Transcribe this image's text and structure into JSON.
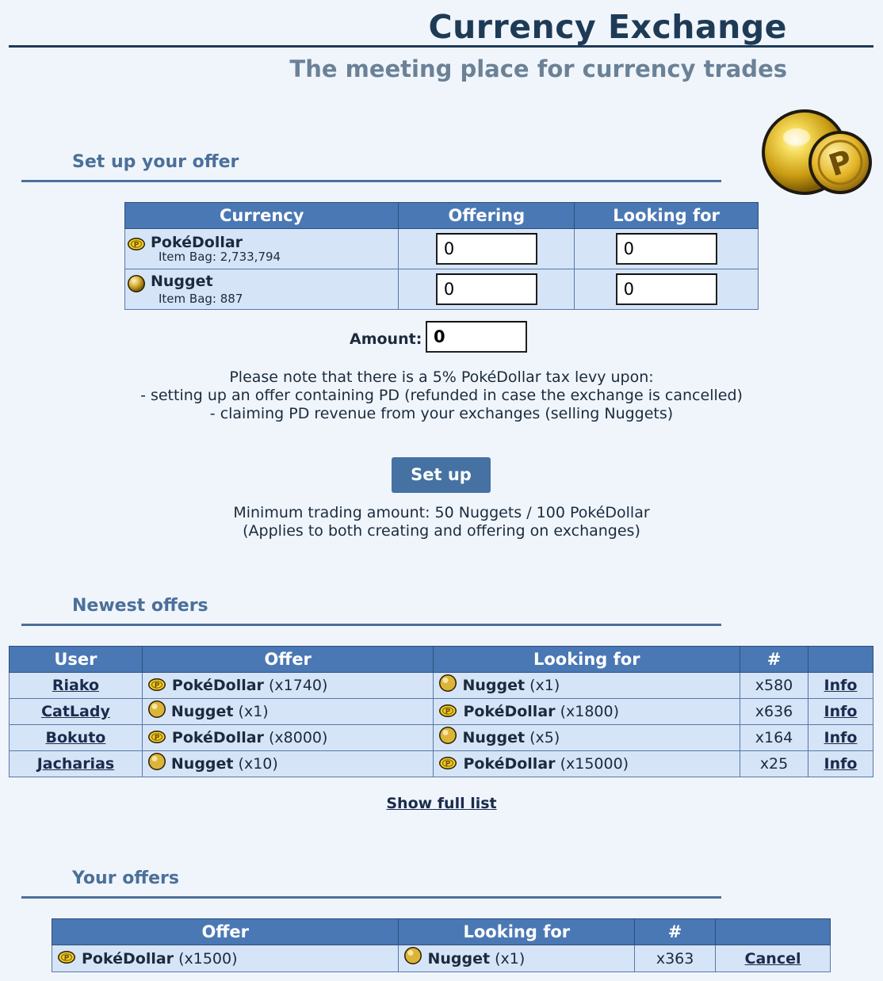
{
  "header": {
    "title": "Currency Exchange",
    "subtitle": "The meeting place for currency trades"
  },
  "setup": {
    "section_title": "Set up your offer",
    "columns": [
      "Currency",
      "Offering",
      "Looking for"
    ],
    "rows": [
      {
        "icon": "pokedollar-icon",
        "name": "PokéDollar",
        "bag": "Item Bag: 2,733,794",
        "offering": "0",
        "looking": "0"
      },
      {
        "icon": "nugget-icon",
        "name": "Nugget",
        "bag": "Item Bag: 887",
        "offering": "0",
        "looking": "0"
      }
    ],
    "amount_label": "Amount:",
    "amount_value": "0",
    "tax_note": [
      "Please note that there is a 5% PokéDollar tax levy upon:",
      "- setting up an offer containing PD (refunded in case the exchange is cancelled)",
      "- claiming PD revenue from your exchanges (selling Nuggets)"
    ],
    "button_label": "Set up",
    "min_note": [
      "Minimum trading amount: 50 Nuggets / 100 PokéDollar",
      "(Applies to both creating and offering on exchanges)"
    ]
  },
  "newest": {
    "section_title": "Newest offers",
    "columns": [
      "User",
      "Offer",
      "Looking for",
      "#",
      ""
    ],
    "rows": [
      {
        "user": "Riako",
        "offer_icon": "pokedollar-icon",
        "offer_name": "PokéDollar",
        "offer_qty": "(x1740)",
        "want_icon": "nugget-icon",
        "want_name": "Nugget",
        "want_qty": "(x1)",
        "count": "x580",
        "info": "Info"
      },
      {
        "user": "CatLady",
        "offer_icon": "nugget-icon",
        "offer_name": "Nugget",
        "offer_qty": "(x1)",
        "want_icon": "pokedollar-icon",
        "want_name": "PokéDollar",
        "want_qty": "(x1800)",
        "count": "x636",
        "info": "Info"
      },
      {
        "user": "Bokuto",
        "offer_icon": "pokedollar-icon",
        "offer_name": "PokéDollar",
        "offer_qty": "(x8000)",
        "want_icon": "nugget-icon",
        "want_name": "Nugget",
        "want_qty": "(x5)",
        "count": "x164",
        "info": "Info"
      },
      {
        "user": "Jacharias",
        "offer_icon": "nugget-icon",
        "offer_name": "Nugget",
        "offer_qty": "(x10)",
        "want_icon": "pokedollar-icon",
        "want_name": "PokéDollar",
        "want_qty": "(x15000)",
        "count": "x25",
        "info": "Info"
      }
    ],
    "show_full": "Show full list"
  },
  "yours": {
    "section_title": "Your offers",
    "columns": [
      "Offer",
      "Looking for",
      "#",
      ""
    ],
    "rows": [
      {
        "offer_icon": "pokedollar-icon",
        "offer_name": "PokéDollar",
        "offer_qty": "(x1500)",
        "want_icon": "nugget-icon",
        "want_name": "Nugget",
        "want_qty": "(x1)",
        "count": "x363",
        "action": "Cancel"
      }
    ]
  },
  "colors": {
    "page_bg": "#f0f5fc",
    "header_bg": "#4a78b4",
    "cell_bg": "#d6e4f7",
    "accent": "#4b7099",
    "button_bg": "#4572a2"
  }
}
